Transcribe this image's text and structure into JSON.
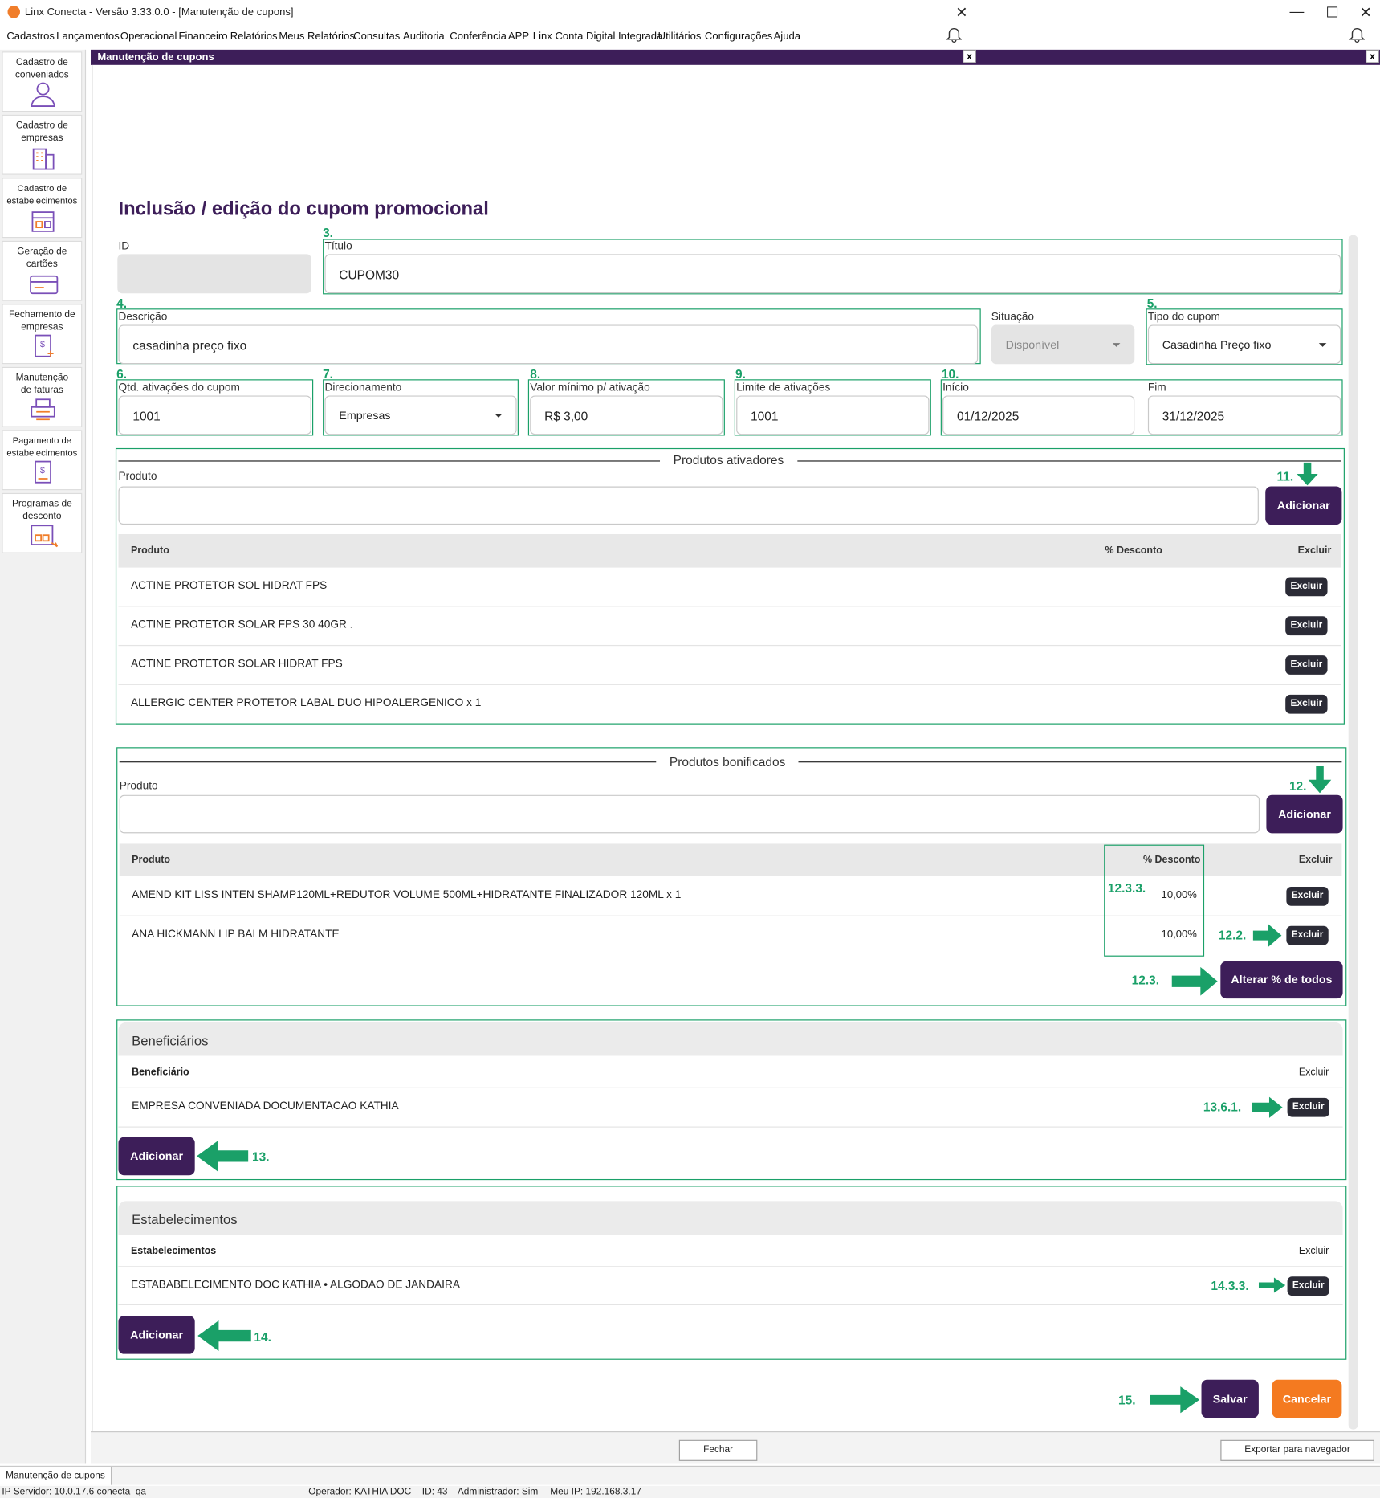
{
  "window": {
    "title": "Linx Conecta - Versão 3.33.0.0 - [Manutenção de cupons]",
    "minimize": "—",
    "maximize": "☐",
    "close": "✕",
    "inner_close": "✕"
  },
  "menu": [
    "Cadastros",
    "Lançamentos",
    "Operacional",
    "Financeiro",
    "Relatórios",
    "Meus Relatórios",
    "Consultas",
    "Auditoria",
    "Conferência",
    "APP",
    "Linx Conta Digital Integrada",
    "Utilitários",
    "Configurações",
    "Ajuda"
  ],
  "sidebar": [
    {
      "label": "Cadastro de conveniados",
      "icon": "person-icon"
    },
    {
      "label": "Cadastro de empresas",
      "icon": "building-icon"
    },
    {
      "label": "Cadastro de estabelecimentos",
      "icon": "store-icon"
    },
    {
      "label": "Geração de cartões",
      "icon": "card-icon"
    },
    {
      "label": "Fechamento de empresas",
      "icon": "invoice-icon"
    },
    {
      "label": "Manutenção de faturas",
      "icon": "printer-icon"
    },
    {
      "label": "Pagamento de estabelecimentos",
      "icon": "payment-icon"
    },
    {
      "label": "Programas de desconto",
      "icon": "discount-icon"
    }
  ],
  "header": {
    "title": "Manutenção de cupons",
    "close": "x"
  },
  "form": {
    "heading": "Inclusão / edição do cupom promocional",
    "id_label": "ID",
    "id_value": "",
    "titulo_label": "Título",
    "titulo_value": "CUPOM30",
    "descricao_label": "Descrição",
    "descricao_value": "casadinha preço fixo",
    "situacao_label": "Situação",
    "situacao_value": "Disponível",
    "tipo_label": "Tipo do cupom",
    "tipo_value": "Casadinha Preço fixo",
    "qtd_label": "Qtd. ativações do cupom",
    "qtd_value": "1001",
    "direc_label": "Direcionamento",
    "direc_value": "Empresas",
    "valor_label": "Valor mínimo p/ ativação",
    "valor_value": "R$ 3,00",
    "limite_label": "Limite de ativações",
    "limite_value": "1001",
    "inicio_label": "Início",
    "inicio_value": "01/12/2025",
    "fim_label": "Fim",
    "fim_value": "31/12/2025"
  },
  "annotations": {
    "n3": "3.",
    "n4": "4.",
    "n5": "5.",
    "n6": "6.",
    "n7": "7.",
    "n8": "8.",
    "n9": "9.",
    "n10": "10.",
    "n11": "11.",
    "n12": "12.",
    "n12_3_3": "12.3.3.",
    "n12_2": "12.2.",
    "n12_3": "12.3.",
    "n13_6_1": "13.6.1.",
    "n13": "13.",
    "n14_3_3": "14.3.3.",
    "n14": "14.",
    "n15": "15."
  },
  "ativadores": {
    "title": "Produtos ativadores",
    "produto_label": "Produto",
    "add": "Adicionar",
    "cols": {
      "produto": "Produto",
      "desconto": "% Desconto",
      "excluir": "Excluir"
    },
    "rows": [
      {
        "name": "ACTINE PROTETOR SOL HIDRAT FPS",
        "btn": "Excluir"
      },
      {
        "name": "ACTINE PROTETOR SOLAR FPS 30 40GR .",
        "btn": "Excluir"
      },
      {
        "name": "ACTINE PROTETOR SOLAR HIDRAT FPS",
        "btn": "Excluir"
      },
      {
        "name": "ALLERGIC CENTER PROTETOR LABAL DUO HIPOALERGENICO x 1",
        "btn": "Excluir"
      }
    ]
  },
  "bonificados": {
    "title": "Produtos bonificados",
    "produto_label": "Produto",
    "add": "Adicionar",
    "cols": {
      "produto": "Produto",
      "desconto": "% Desconto",
      "excluir": "Excluir"
    },
    "rows": [
      {
        "name": "AMEND KIT LISS INTEN SHAMP120ML+REDUTOR VOLUME 500ML+HIDRATANTE FINALIZADOR 120ML x 1",
        "pct": "10,00%",
        "btn": "Excluir"
      },
      {
        "name": "ANA HICKMANN LIP BALM HIDRATANTE",
        "pct": "10,00%",
        "btn": "Excluir"
      }
    ],
    "alterar": "Alterar % de todos"
  },
  "beneficiarios": {
    "title": "Beneficiários",
    "col": "Beneficiário",
    "col_excluir": "Excluir",
    "rows": [
      {
        "name": "EMPRESA CONVENIADA DOCUMENTACAO KATHIA",
        "btn": "Excluir"
      }
    ],
    "add": "Adicionar"
  },
  "estabelecimentos": {
    "title": "Estabelecimentos",
    "col": "Estabelecimentos",
    "col_excluir": "Excluir",
    "rows": [
      {
        "name": "ESTABABELECIMENTO DOC KATHIA • ALGODAO DE JANDAIRA",
        "btn": "Excluir"
      }
    ],
    "add": "Adicionar"
  },
  "actions": {
    "salvar": "Salvar",
    "cancelar": "Cancelar"
  },
  "bottom": {
    "fechar": "Fechar",
    "exportar": "Exportar para navegador",
    "tab": "Manutenção de cupons"
  },
  "status": {
    "servidor": "IP Servidor: 10.0.17.6 conecta_qa",
    "operador": "Operador: KATHIA DOC",
    "id": "ID: 43",
    "admin": "Administrador: Sim",
    "meuip": "Meu IP: 192.168.3.17"
  },
  "colors": {
    "primary": "#3d1e59",
    "accent": "#f47a20",
    "annotation": "#1aa068"
  }
}
